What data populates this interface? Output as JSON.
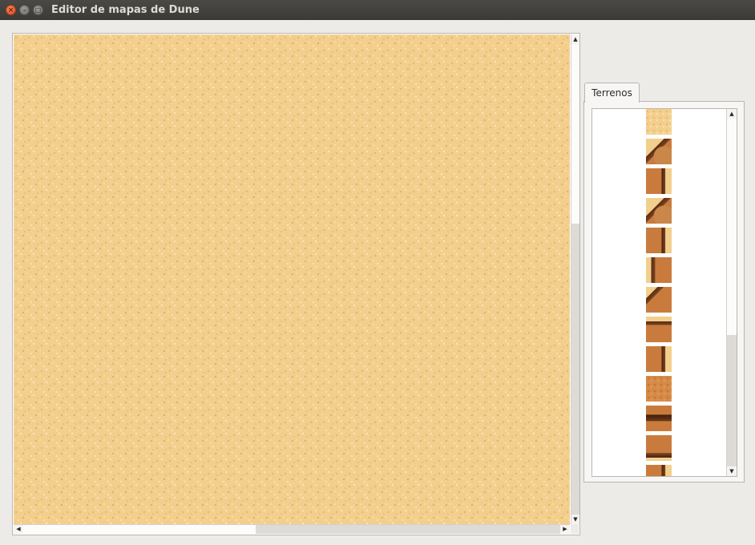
{
  "window": {
    "title": "Editor de mapas de Dune",
    "controls": {
      "close_icon": "×",
      "minimize_icon": "–",
      "maximize_icon": "□"
    }
  },
  "map": {
    "terrain": "sand",
    "vscroll": {
      "up_icon": "▲",
      "down_icon": "▼"
    },
    "hscroll": {
      "left_icon": "◀",
      "right_icon": "▶"
    }
  },
  "panel": {
    "tabs": [
      {
        "label": "Terrenos",
        "selected": true
      }
    ],
    "tiles": [
      {
        "name": "sand"
      },
      {
        "name": "rock-corner"
      },
      {
        "name": "rock-side"
      },
      {
        "name": "rock-corner"
      },
      {
        "name": "rock-side"
      },
      {
        "name": "rock-edge-l"
      },
      {
        "name": "rock-corner-tl"
      },
      {
        "name": "rock-top"
      },
      {
        "name": "rock-side"
      },
      {
        "name": "rock-full"
      },
      {
        "name": "rock-mid"
      },
      {
        "name": "rock-bottom"
      },
      {
        "name": "rock-side"
      }
    ],
    "scroll": {
      "up_icon": "▲",
      "down_icon": "▼"
    }
  },
  "colors": {
    "sand": "#f3cf8e",
    "rock": "#c97b3d",
    "titlebar": "#3b3a36",
    "window_bg": "#edebe8"
  }
}
